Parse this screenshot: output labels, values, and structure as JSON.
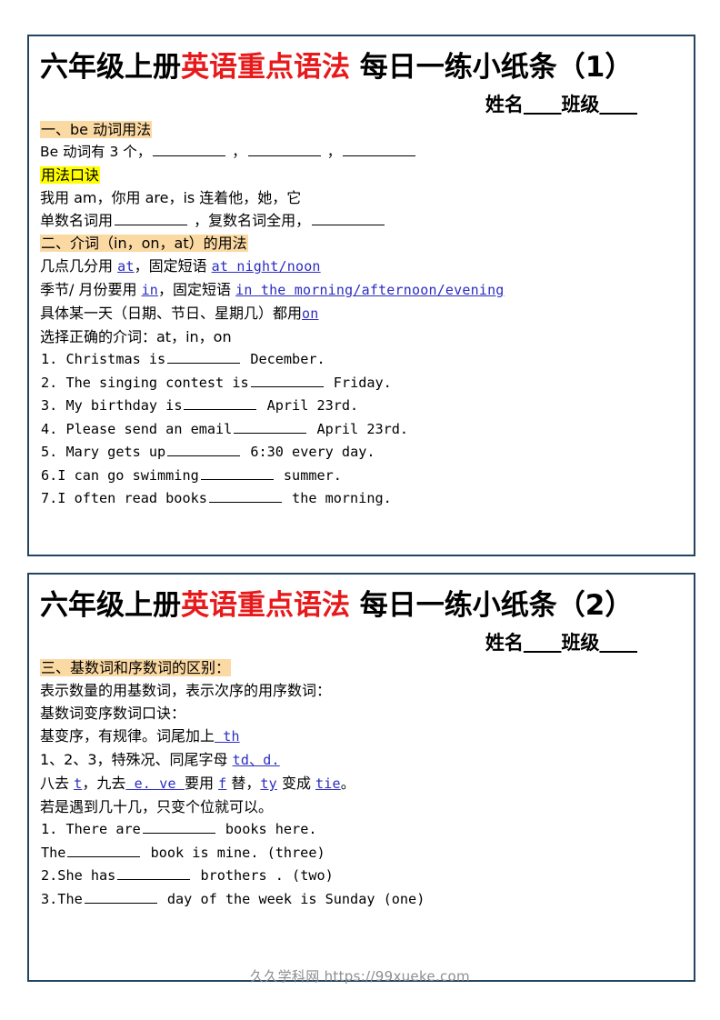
{
  "page": {
    "watermark": "久久学科网 https://99xueke.com",
    "colors": {
      "border": "#23455f",
      "title_accent": "#e8191b",
      "highlight_peach": "#fbd9a2",
      "highlight_yellow": "#ffff00",
      "blue_text": "#2b2bc4",
      "watermark": "#8e8e93"
    }
  },
  "cards": [
    {
      "title_pre": "六年级上册",
      "title_accent": "英语重点语法",
      "title_post": " 每日一练小纸条（1）",
      "name_label": "姓名",
      "class_label": "班级",
      "sections": [
        {
          "heading": "一、be 动词用法",
          "heading_highlight": "peach",
          "lines": [
            {
              "segments": [
                {
                  "text": "Be 动词有 3 个，",
                  "style": "plain"
                },
                {
                  "text": "",
                  "style": "blank-md"
                },
                {
                  "text": " ，",
                  "style": "plain"
                },
                {
                  "text": "",
                  "style": "blank-md"
                },
                {
                  "text": " ，",
                  "style": "plain"
                },
                {
                  "text": "",
                  "style": "blank-md"
                }
              ]
            }
          ]
        },
        {
          "heading": "用法口诀",
          "heading_highlight": "yellow",
          "lines": [
            {
              "segments": [
                {
                  "text": "我用 am，你用 are，is 连着他，她，它",
                  "style": "plain"
                }
              ]
            },
            {
              "segments": [
                {
                  "text": "单数名词用",
                  "style": "plain"
                },
                {
                  "text": "",
                  "style": "blank-md"
                },
                {
                  "text": " ，复数名词全用，",
                  "style": "plain"
                },
                {
                  "text": "",
                  "style": "blank-md"
                }
              ]
            }
          ]
        },
        {
          "heading": "二、介词（in，on，at）的用法",
          "heading_highlight": "peach",
          "lines": [
            {
              "segments": [
                {
                  "text": "几点几分用 ",
                  "style": "plain"
                },
                {
                  "text": "at",
                  "style": "blue"
                },
                {
                  "text": "，固定短语 ",
                  "style": "plain"
                },
                {
                  "text": "at night/noon",
                  "style": "blue"
                }
              ]
            },
            {
              "segments": [
                {
                  "text": "季节/ 月份要用 ",
                  "style": "plain"
                },
                {
                  "text": "in",
                  "style": "blue"
                },
                {
                  "text": "，固定短语 ",
                  "style": "plain"
                },
                {
                  "text": "in the morning/afternoon/evening",
                  "style": "blue"
                }
              ]
            },
            {
              "segments": [
                {
                  "text": "具体某一天（日期、节日、星期几）都用",
                  "style": "plain"
                },
                {
                  "text": "on",
                  "style": "blue"
                }
              ]
            },
            {
              "segments": [
                {
                  "text": "选择正确的介词：at，in，on",
                  "style": "plain"
                }
              ]
            }
          ]
        }
      ],
      "questions": [
        {
          "num": "1.",
          "before": "Christmas is",
          "blank": "md",
          "after": "December."
        },
        {
          "num": "2.",
          "before": "The singing contest is",
          "blank": "md",
          "after": "Friday."
        },
        {
          "num": "3.",
          "before": "My birthday is",
          "blank": "md",
          "after": "April 23rd."
        },
        {
          "num": "4.",
          "before": "Please send an email",
          "blank": "md",
          "after": "April 23rd."
        },
        {
          "num": "5.",
          "before": "Mary gets up",
          "blank": "md",
          "after": "6:30 every day."
        },
        {
          "num": "6.",
          "before": "I can go swimming",
          "blank": "md",
          "after": "summer."
        },
        {
          "num": "7.",
          "before": "I often read books",
          "blank": "md",
          "after": "the morning."
        }
      ]
    },
    {
      "title_pre": "六年级上册",
      "title_accent": "英语重点语法",
      "title_post": " 每日一练小纸条（2）",
      "name_label": "姓名",
      "class_label": "班级",
      "sections": [
        {
          "heading": "三、基数词和序数词的区别：",
          "heading_highlight": "peach",
          "lines": [
            {
              "segments": [
                {
                  "text": "表示数量的用基数词，表示次序的用序数词：",
                  "style": "plain"
                }
              ]
            },
            {
              "segments": [
                {
                  "text": "基数词变序数词口诀：",
                  "style": "plain"
                }
              ]
            },
            {
              "segments": [
                {
                  "text": "基变序，有规律。词尾加上",
                  "style": "plain"
                },
                {
                  "text": " th",
                  "style": "blue"
                }
              ]
            },
            {
              "segments": [
                {
                  "text": "1、2、3，特殊况、同尾字母 ",
                  "style": "plain"
                },
                {
                  "text": "td、d.",
                  "style": "blue"
                }
              ]
            },
            {
              "segments": [
                {
                  "text": "八去 ",
                  "style": "plain"
                },
                {
                  "text": "t",
                  "style": "blue"
                },
                {
                  "text": "，九去",
                  "style": "plain"
                },
                {
                  "text": " e. ve ",
                  "style": "blue"
                },
                {
                  "text": "要用 ",
                  "style": "plain"
                },
                {
                  "text": "f",
                  "style": "blue"
                },
                {
                  "text": " 替，",
                  "style": "plain"
                },
                {
                  "text": "ty",
                  "style": "blue"
                },
                {
                  "text": " 变成 ",
                  "style": "plain"
                },
                {
                  "text": "tie",
                  "style": "blue"
                },
                {
                  "text": "。",
                  "style": "plain"
                }
              ]
            },
            {
              "segments": [
                {
                  "text": "若是遇到几十几，只变个位就可以。",
                  "style": "plain"
                }
              ]
            }
          ]
        }
      ],
      "questions": [
        {
          "num": "1.",
          "before": "There are",
          "blank": "md",
          "after": "books here."
        },
        {
          "num": "",
          "before": "The",
          "blank": "md",
          "after": "book is mine. (three)"
        },
        {
          "num": "2.",
          "before": "She has",
          "blank": "md",
          "after": "brothers . (two)"
        },
        {
          "num": "3.",
          "before": "The",
          "blank": "md",
          "after": "day of the week is Sunday (one)"
        }
      ]
    }
  ]
}
